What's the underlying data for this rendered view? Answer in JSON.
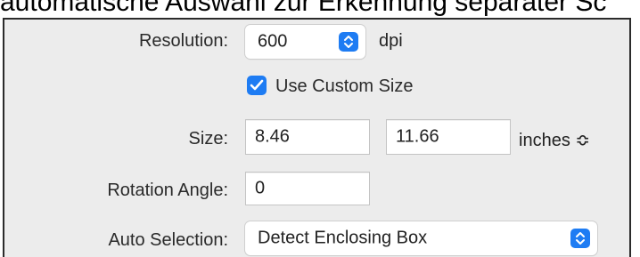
{
  "caption": "automatische Auswahl zur Erkennung separater Sc",
  "resolution": {
    "label": "Resolution:",
    "value": "600",
    "unit": "dpi",
    "stepper_icon": "up-down-chevrons-icon"
  },
  "custom_size": {
    "label": "Use Custom Size",
    "checked": true
  },
  "size": {
    "label": "Size:",
    "width": "8.46",
    "height": "11.66",
    "unit": "inches ≎"
  },
  "rotation": {
    "label": "Rotation Angle:",
    "value": "0"
  },
  "auto_selection": {
    "label": "Auto Selection:",
    "value": "Detect Enclosing Box",
    "stepper_icon": "up-down-chevrons-icon"
  },
  "colors": {
    "accent": "#1e7cf3",
    "panel_bg": "#ececec",
    "label_text": "#2a2a2a"
  }
}
